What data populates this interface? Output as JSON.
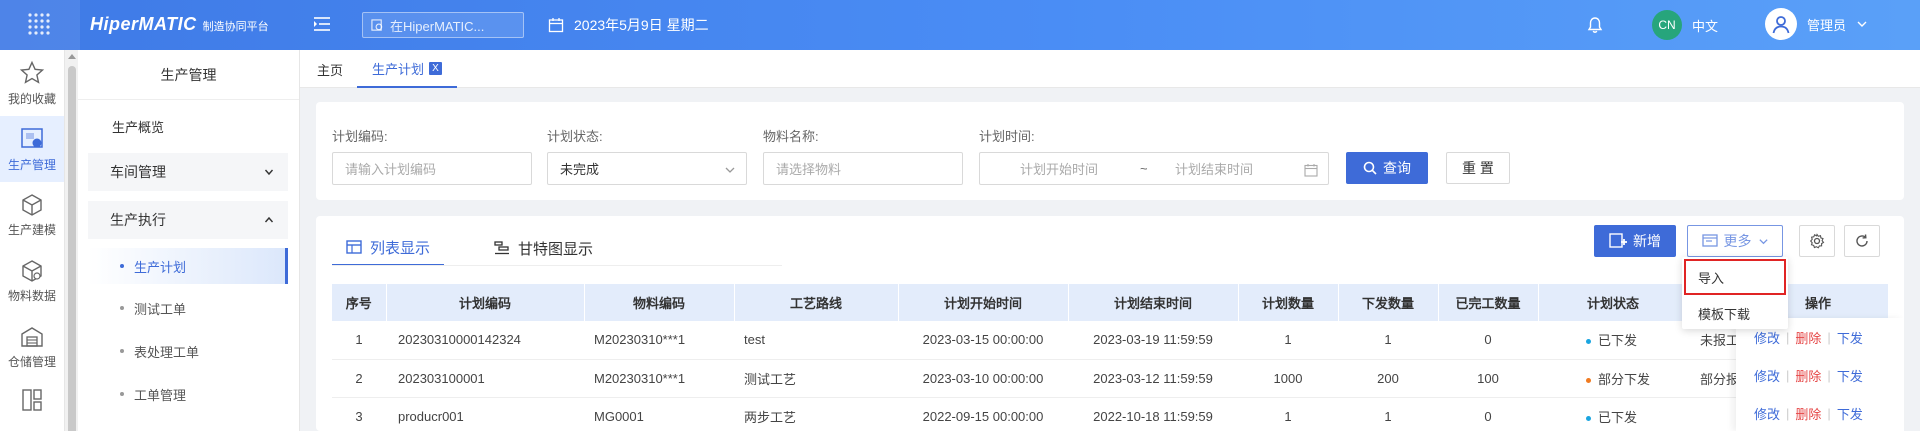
{
  "app": {
    "name": "HiperMATIC",
    "subtitle": "制造协同平台"
  },
  "header": {
    "search_placeholder": "在HiperMATIC...",
    "date": "2023年5月9日 星期二",
    "lang_badge": "CN",
    "lang_label": "中文",
    "user_label": "管理员"
  },
  "rail": {
    "items": [
      {
        "label": "我的收藏",
        "icon": "star-icon"
      },
      {
        "label": "生产管理",
        "icon": "production-icon"
      },
      {
        "label": "生产建模",
        "icon": "cube-icon"
      },
      {
        "label": "物料数据",
        "icon": "material-cube-icon"
      },
      {
        "label": "仓储管理",
        "icon": "warehouse-icon"
      },
      {
        "label": "",
        "icon": "report-icon"
      }
    ]
  },
  "sidebar": {
    "title": "生产管理",
    "overview": "生产概览",
    "groups": [
      {
        "label": "车间管理"
      },
      {
        "label": "生产执行"
      }
    ],
    "sub_items": [
      "生产计划",
      "测试工单",
      "表处理工单",
      "工单管理"
    ]
  },
  "tabs": [
    {
      "label": "主页"
    },
    {
      "label": "生产计划",
      "close": "X"
    }
  ],
  "filters": {
    "plan_code": {
      "label": "计划编码:",
      "placeholder": "请输入计划编码"
    },
    "plan_status": {
      "label": "计划状态:",
      "value": "未完成"
    },
    "material": {
      "label": "物料名称:",
      "placeholder": "请选择物料"
    },
    "plan_time": {
      "label": "计划时间:",
      "start_placeholder": "计划开始时间",
      "sep": "~",
      "end_placeholder": "计划结束时间"
    },
    "query_label": "查询",
    "reset_label": "重 置"
  },
  "view_tabs": {
    "list": "列表显示",
    "gantt": "甘特图显示"
  },
  "toolbar": {
    "new_label": "新增",
    "more_label": "更多"
  },
  "more_menu": {
    "import": "导入",
    "template_download": "模板下载"
  },
  "table": {
    "headers": [
      "序号",
      "计划编码",
      "物料编码",
      "工艺路线",
      "计划开始时间",
      "计划结束时间",
      "计划数量",
      "下发数量",
      "已完工数量",
      "计划状态",
      "",
      "操作"
    ],
    "rows": [
      {
        "index": "1",
        "code": "20230310000142324",
        "material": "M20230310***1",
        "route": "test",
        "start": "2023-03-15 00:00:00",
        "end": "2023-03-19 11:59:59",
        "qty": "1",
        "issued": "1",
        "done": "0",
        "status": "已下发",
        "status_color": "#1aa5e0",
        "report": "未报工"
      },
      {
        "index": "2",
        "code": "202303100001",
        "material": "M20230310***1",
        "route": "测试工艺",
        "start": "2023-03-10 00:00:00",
        "end": "2023-03-12 11:59:59",
        "qty": "1000",
        "issued": "200",
        "done": "100",
        "status": "部分下发",
        "status_color": "#f07b21",
        "report": "部分报"
      },
      {
        "index": "3",
        "code": "producr001",
        "material": "MG0001",
        "route": "两步工艺",
        "start": "2022-09-15 00:00:00",
        "end": "2022-10-18 11:59:59",
        "qty": "1",
        "issued": "1",
        "done": "0",
        "status": "已下发",
        "status_color": "#1aa5e0",
        "report": ""
      }
    ],
    "actions": {
      "edit": "修改",
      "delete": "删除",
      "issue": "下发"
    }
  },
  "colors": {
    "primary": "#3e6bd8",
    "danger": "#e54545",
    "highlight_border": "#e02424"
  }
}
